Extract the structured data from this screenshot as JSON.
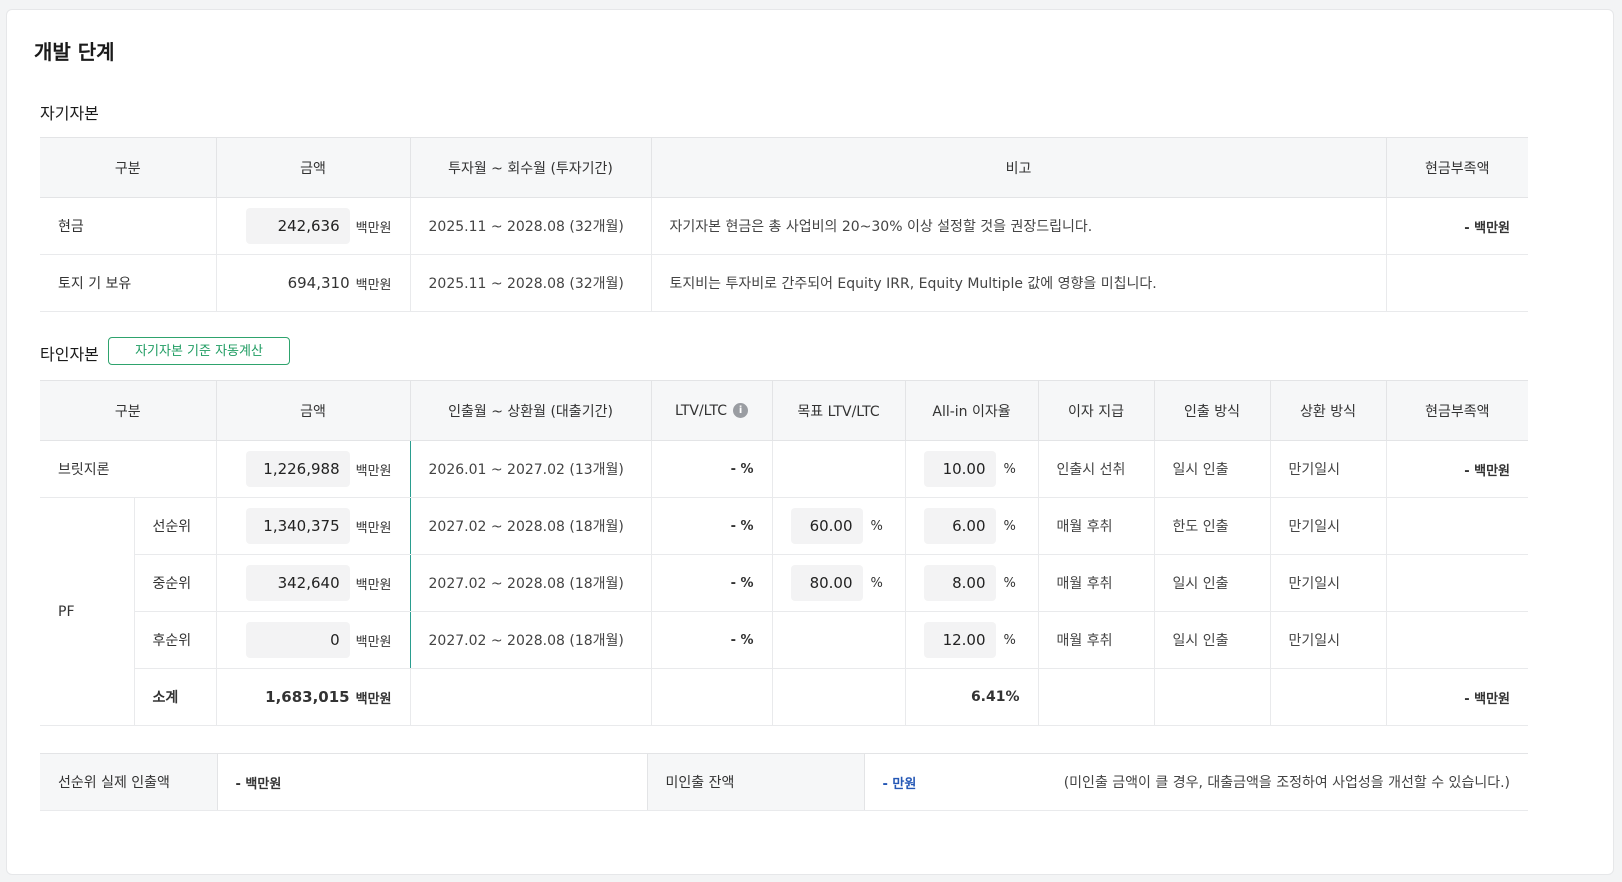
{
  "page_title": "개발 단계",
  "equity": {
    "title": "자기자본",
    "headers": [
      "구분",
      "금액",
      "투자월 ~ 회수월 (투자기간)",
      "비고",
      "현금부족액"
    ],
    "rows": [
      {
        "label": "현금",
        "amount": "242,636",
        "unit": "백만원",
        "period": "2025.11 ~ 2028.08 (32개월)",
        "note": "자기자본 현금은 총 사업비의 20~30% 이상 설정할 것을 권장드립니다.",
        "shortfall": "- 백만원"
      },
      {
        "label": "토지 기 보유",
        "amount": "694,310",
        "unit": "백만원",
        "period": "2025.11 ~ 2028.08 (32개월)",
        "note": "토지비는 투자비로 간주되어 Equity IRR, Equity Multiple 값에 영향을 미칩니다.",
        "shortfall": ""
      }
    ]
  },
  "debt": {
    "title": "타인자본",
    "auto_button": "자기자본 기준 자동계산",
    "headers": [
      "구분",
      "금액",
      "인출월 ~ 상환월 (대출기간)",
      "LTV/LTC",
      "목표 LTV/LTC",
      "All-in 이자율",
      "이자 지급",
      "인출 방식",
      "상환 방식",
      "현금부족액"
    ],
    "info_icon": "i",
    "bridge": {
      "label": "브릿지론",
      "amount": "1,226,988",
      "unit": "백만원",
      "period": "2026.01 ~ 2027.02 (13개월)",
      "ltv": "- %",
      "target": "",
      "rate": "10.00",
      "pct": "%",
      "interest": "인출시 선취",
      "draw": "일시 인출",
      "repay": "만기일시",
      "shortfall": "- 백만원"
    },
    "pf_label": "PF",
    "pf": [
      {
        "label": "선순위",
        "amount": "1,340,375",
        "unit": "백만원",
        "period": "2027.02 ~ 2028.08 (18개월)",
        "ltv": "- %",
        "target": "60.00",
        "rate": "6.00",
        "pct": "%",
        "interest": "매월 후취",
        "draw": "한도 인출",
        "repay": "만기일시"
      },
      {
        "label": "중순위",
        "amount": "342,640",
        "unit": "백만원",
        "period": "2027.02 ~ 2028.08 (18개월)",
        "ltv": "- %",
        "target": "80.00",
        "rate": "8.00",
        "pct": "%",
        "interest": "매월 후취",
        "draw": "일시 인출",
        "repay": "만기일시"
      },
      {
        "label": "후순위",
        "amount": "0",
        "unit": "백만원",
        "period": "2027.02 ~ 2028.08 (18개월)",
        "ltv": "- %",
        "target": "",
        "rate": "12.00",
        "pct": "%",
        "interest": "매월 후취",
        "draw": "일시 인출",
        "repay": "만기일시"
      }
    ],
    "subtotal": {
      "label": "소계",
      "amount": "1,683,015",
      "unit": "백만원",
      "rate": "6.41",
      "pct": "%",
      "shortfall": "- 백만원"
    }
  },
  "summary": {
    "senior_label": "선순위 실제 인출액",
    "senior_value": "- 백만원",
    "undrawn_label": "미인출 잔액",
    "undrawn_value": "- 만원",
    "note": "(미인출 금액이 클 경우, 대출금액을 조정하여 사업성을 개선할 수 있습니다.)"
  }
}
